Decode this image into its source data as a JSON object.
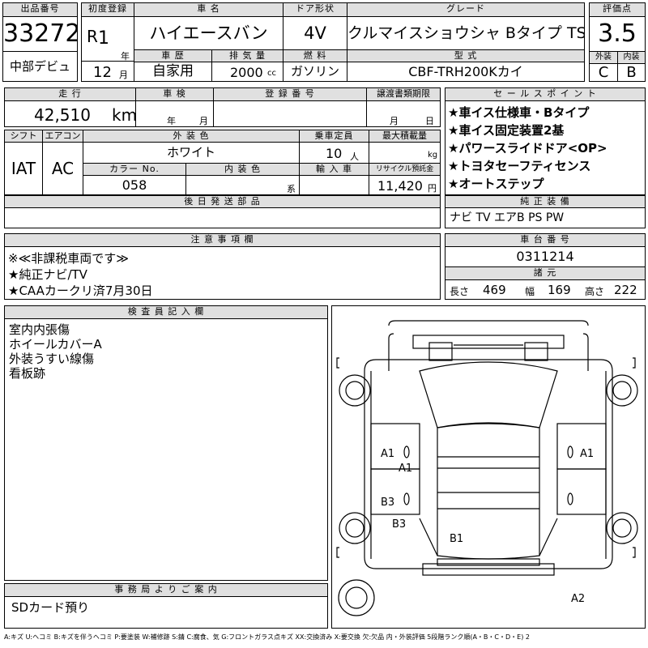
{
  "header": {
    "lot_number_label": "出品番号",
    "lot_number": "33272",
    "debut_label": "中部デビュ",
    "first_reg_label": "初度登録",
    "era": "R",
    "year_value": "1",
    "year_unit": "年",
    "month_value": "12",
    "month_unit": "月",
    "car_name_label": "車 名",
    "car_name": "ハイエースバン",
    "door_label": "ドア形状",
    "door_value": "4V",
    "grade_label": "グレード",
    "grade_value": "クルマイスショウシャ Bタイプ TSS",
    "score_label": "評価点",
    "score_value": "3.5",
    "history_label": "車 歴",
    "history_value": "自家用",
    "displacement_label": "排 気 量",
    "displacement_value": "2000",
    "displacement_unit": "cc",
    "fuel_label": "燃 料",
    "fuel_value": "ガソリン",
    "model_label": "型 式",
    "model_value": "CBF-TRH200Kカイ",
    "exterior_label": "外装",
    "exterior_value": "C",
    "interior_label": "内装",
    "interior_value": "B"
  },
  "middle": {
    "mileage_label": "走 行",
    "mileage_value": "42,510",
    "mileage_unit": "km",
    "inspection_label": "車 検",
    "inspection_year_unit": "年",
    "inspection_month_unit": "月",
    "registration_label": "登 録 番 号",
    "transfer_label": "譲渡書類期限",
    "transfer_month_unit": "月",
    "transfer_day_unit": "日",
    "shift_label": "シフト",
    "shift_value": "IAT",
    "ac_label": "エアコン",
    "ac_value": "AC",
    "color_label": "外 装 色",
    "color_value": "ホワイト",
    "capacity_label": "乗車定員",
    "capacity_value": "10",
    "capacity_unit": "人",
    "load_label": "最大積載量",
    "load_unit": "kg",
    "color_no_label": "カラー No.",
    "color_no_value": "058",
    "int_color_label": "内 装 色",
    "int_color_unit": "系",
    "import_label": "輸 入 車",
    "recycle_label": "リサイクル預託金",
    "recycle_value": "11,420",
    "recycle_unit": "円",
    "later_parts_label": "後 日 発 送 部 品"
  },
  "sales_points": {
    "label": "セ ー ル ス ポ イ ン ト",
    "items": [
      "★車イス仕様車・Bタイプ",
      "★車イス固定装置2基",
      "★パワースライドドア<OP>",
      "★トヨタセーフティセンス",
      "★オートステップ"
    ]
  },
  "genuine": {
    "label": "純 正 装 備",
    "value": "ナビ TV エアB PS PW"
  },
  "notes": {
    "label": "注 意 事 項 欄",
    "lines": [
      "※≪非課税車両です≫",
      "★純正ナビ/TV",
      "★CAAカークリ済7月30日"
    ]
  },
  "chassis": {
    "label": "車 台 番 号",
    "value": "0311214",
    "specs_label": "諸 元",
    "length_label": "長さ",
    "length_value": "469",
    "width_label": "幅",
    "width_value": "169",
    "height_label": "高さ",
    "height_value": "222"
  },
  "inspector": {
    "label": "検 査 員 記 入 欄",
    "lines": [
      "室内内張傷",
      "ホイールカバーA",
      "外装うすい線傷",
      "看板跡"
    ]
  },
  "office": {
    "label": "事 務 局 よ り ご 案 内",
    "message": "SDカード預り"
  },
  "diagram_marks": [
    "A1",
    "A1",
    "A1",
    "B3",
    "B3",
    "B1",
    "A2"
  ],
  "footer": {
    "legend": "A:キズ U:ヘコミ B:キズを伴うヘコミ P:要塗装 W:補修跡 S:錆 C:腐食、気 G:フロントガラス点キズ XX:交換済み X:要交換 欠:欠品 内・外装評価 5段階ランク順(A・B・C・D・E) 2"
  }
}
